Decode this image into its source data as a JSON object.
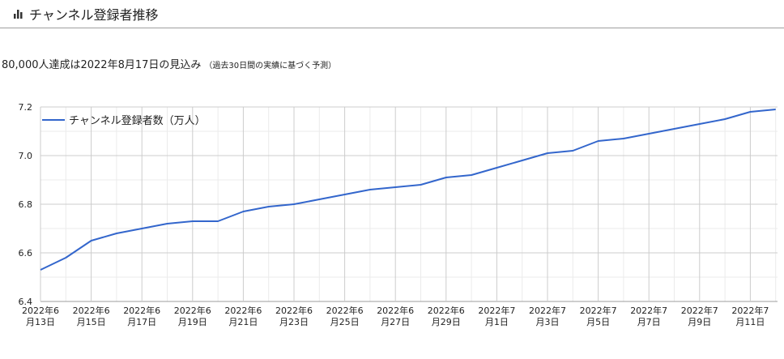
{
  "header": {
    "title": "チャンネル登録者推移",
    "icon": "bar-chart-icon"
  },
  "subtitle": {
    "main": "80,000人達成は2022年8月17日の見込み",
    "note": "（過去30日間の実績に基づく予測）"
  },
  "colors": {
    "line": "#3366cc",
    "grid": "#cccccc",
    "minor_grid": "#ebebeb",
    "text": "#222222"
  },
  "chart_data": {
    "type": "line",
    "ylim": [
      6.4,
      7.2
    ],
    "yticks": [
      "6.4",
      "6.6",
      "6.8",
      "7.0",
      "7.2"
    ],
    "xlabels": [
      [
        "2022年6",
        "月13日"
      ],
      [
        "2022年6",
        "月15日"
      ],
      [
        "2022年6",
        "月17日"
      ],
      [
        "2022年6",
        "月19日"
      ],
      [
        "2022年6",
        "月21日"
      ],
      [
        "2022年6",
        "月23日"
      ],
      [
        "2022年6",
        "月25日"
      ],
      [
        "2022年6",
        "月27日"
      ],
      [
        "2022年6",
        "月29日"
      ],
      [
        "2022年7",
        "月1日"
      ],
      [
        "2022年7",
        "月3日"
      ],
      [
        "2022年7",
        "月5日"
      ],
      [
        "2022年7",
        "月7日"
      ],
      [
        "2022年7",
        "月9日"
      ],
      [
        "2022年7",
        "月11日"
      ]
    ],
    "x": [
      "2022-06-13",
      "2022-06-14",
      "2022-06-15",
      "2022-06-16",
      "2022-06-17",
      "2022-06-18",
      "2022-06-19",
      "2022-06-20",
      "2022-06-21",
      "2022-06-22",
      "2022-06-23",
      "2022-06-24",
      "2022-06-25",
      "2022-06-26",
      "2022-06-27",
      "2022-06-28",
      "2022-06-29",
      "2022-06-30",
      "2022-07-01",
      "2022-07-02",
      "2022-07-03",
      "2022-07-04",
      "2022-07-05",
      "2022-07-06",
      "2022-07-07",
      "2022-07-08",
      "2022-07-09",
      "2022-07-10",
      "2022-07-11",
      "2022-07-12"
    ],
    "series": [
      {
        "name": "チャンネル登録者数（万人）",
        "values": [
          6.53,
          6.58,
          6.65,
          6.68,
          6.7,
          6.72,
          6.73,
          6.73,
          6.77,
          6.79,
          6.8,
          6.82,
          6.84,
          6.86,
          6.87,
          6.88,
          6.91,
          6.92,
          6.95,
          6.98,
          7.01,
          7.02,
          7.06,
          7.07,
          7.09,
          7.11,
          7.13,
          7.15,
          7.18,
          7.19
        ]
      }
    ],
    "legend": "top-left",
    "grid": true
  }
}
